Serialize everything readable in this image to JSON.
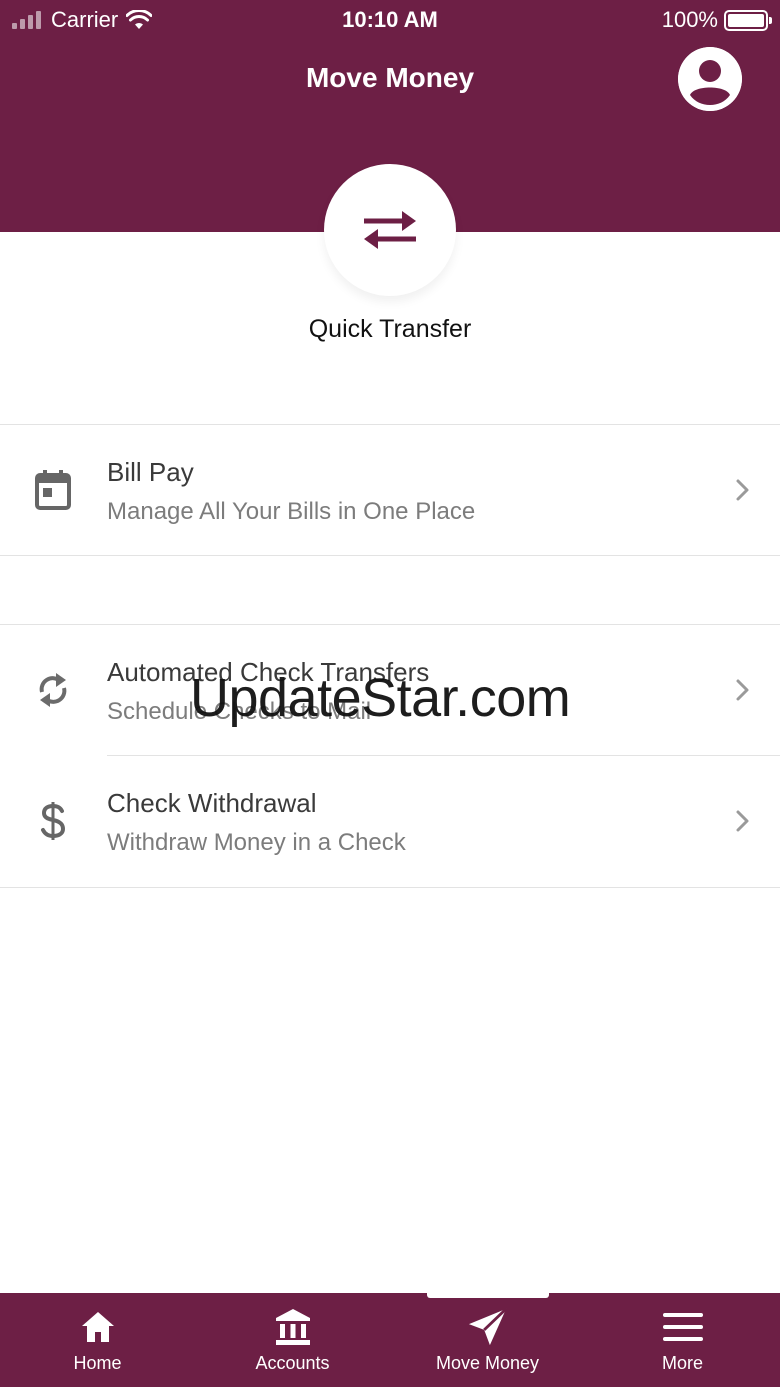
{
  "status_bar": {
    "carrier": "Carrier",
    "time": "10:10 AM",
    "battery": "100%"
  },
  "header": {
    "title": "Move Money",
    "profile_icon": "account-circle-icon"
  },
  "quick_transfer": {
    "label": "Quick Transfer",
    "icon": "swap-arrows-icon"
  },
  "menu": {
    "items": [
      {
        "title": "Bill Pay",
        "subtitle": "Manage All Your Bills in One Place",
        "icon": "calendar-icon"
      },
      {
        "title": "Automated Check Transfers",
        "subtitle": "Schedule Checks to Mail",
        "icon": "refresh-icon"
      },
      {
        "title": "Check Withdrawal",
        "subtitle": "Withdraw Money in a Check",
        "icon": "dollar-icon"
      }
    ]
  },
  "watermark": "UpdateStar.com",
  "tabbar": {
    "tabs": [
      {
        "label": "Home",
        "icon": "home-icon"
      },
      {
        "label": "Accounts",
        "icon": "bank-icon"
      },
      {
        "label": "Move Money",
        "icon": "send-icon",
        "active": true
      },
      {
        "label": "More",
        "icon": "menu-icon"
      }
    ]
  },
  "colors": {
    "brand": "#6d1f45",
    "text_primary": "#3a3a3a",
    "text_secondary": "#7c7c7c"
  }
}
